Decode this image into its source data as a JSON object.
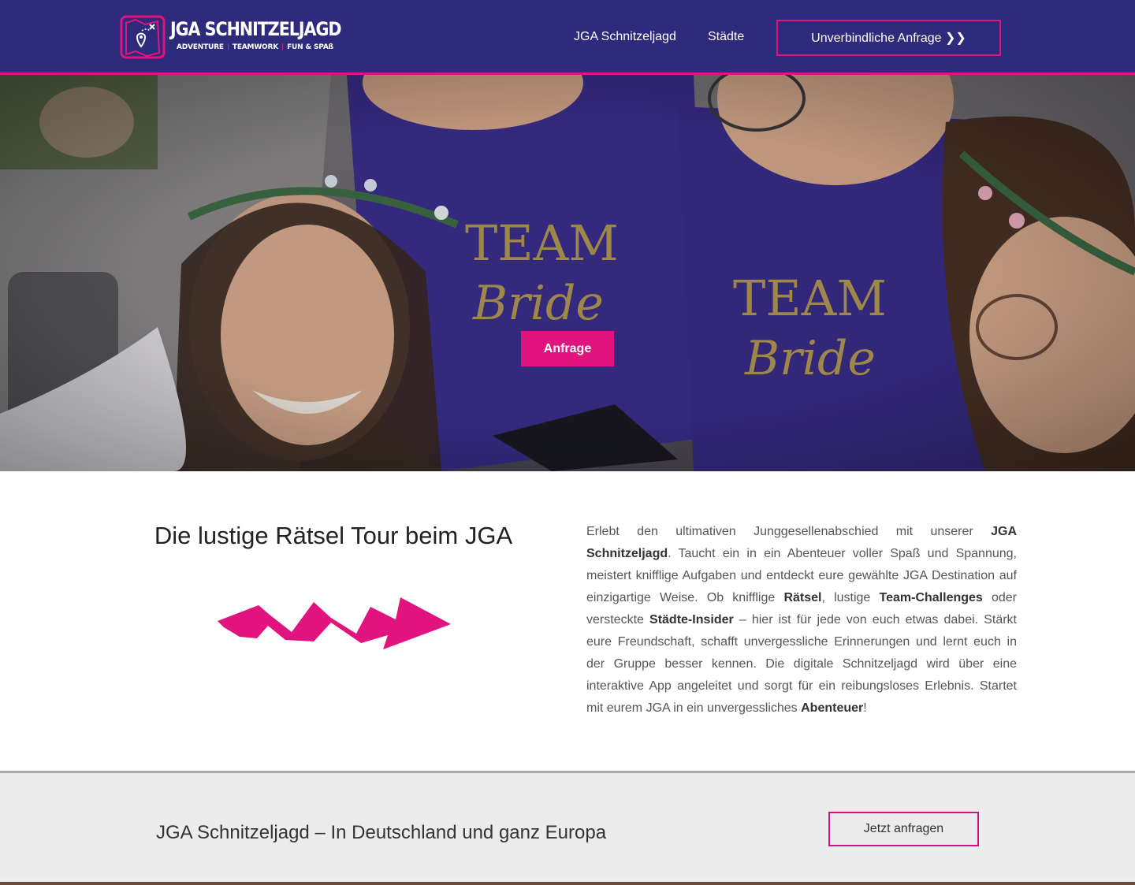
{
  "header": {
    "logo": {
      "title": "JGA SCHNITZELJAGD",
      "tagline": [
        "ADVENTURE",
        "TEAMWORK",
        "FUN & SPAß"
      ]
    },
    "nav": [
      "JGA Schnitzeljagd",
      "Städte"
    ],
    "cta_label": "Unverbindliche Anfrage ❯❯"
  },
  "hero": {
    "button_label": "Anfrage",
    "shirt_text": [
      "TEAM",
      "Bride"
    ]
  },
  "intro": {
    "title": "Die lustige Rätsel Tour beim JGA",
    "text": [
      {
        "t": "Erlebt den ultimativen Junggesellenabschied mit unserer ",
        "b": false
      },
      {
        "t": "JGA Schnitzeljagd",
        "b": true
      },
      {
        "t": ". Taucht ein in ein Abenteuer voller Spaß und Spannung, meistert knifflige Aufgaben und entdeckt eure gewählte JGA Destination auf einzigartige Weise. Ob knifflige ",
        "b": false
      },
      {
        "t": "Rätsel",
        "b": true
      },
      {
        "t": ", lustige ",
        "b": false
      },
      {
        "t": "Team-Challenges",
        "b": true
      },
      {
        "t": " oder versteckte ",
        "b": false
      },
      {
        "t": "Städte-Insider",
        "b": true
      },
      {
        "t": " – hier ist für jede von euch etwas dabei. Stärkt eure Freundschaft, schafft unvergessliche Erinnerungen und lernt euch in der Gruppe besser kennen. Die digitale Schnitzeljagd wird über eine interaktive App angeleitet und sorgt für ein reibungsloses Erlebnis. Startet mit eurem JGA in ein unvergessliches ",
        "b": false
      },
      {
        "t": "Abenteuer",
        "b": true
      },
      {
        "t": "!",
        "b": false
      }
    ]
  },
  "band": {
    "title": "JGA Schnitzeljagd – In Deutschland und ganz Europa",
    "button_label": "Jetzt anfragen"
  },
  "colors": {
    "header_bg": "#2e2a7c",
    "accent": "#e0137f",
    "band_bg": "#ececec"
  }
}
